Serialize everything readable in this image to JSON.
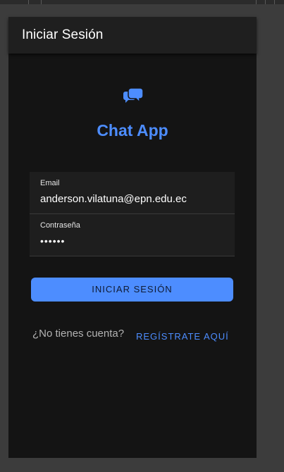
{
  "window": {
    "top_ticks": [
      40,
      58,
      363,
      376,
      389
    ]
  },
  "appbar": {
    "title": "Iniciar Sesión"
  },
  "brand": {
    "icon": "chat-bubbles-icon",
    "name": "Chat App",
    "accent_color": "#4d8dff"
  },
  "form": {
    "email": {
      "label": "Email",
      "value": "anderson.vilatuna@epn.edu.ec"
    },
    "password": {
      "label": "Contraseña",
      "value": "••••••"
    }
  },
  "actions": {
    "login_label": "INICIAR SESIÓN",
    "no_account_text": "¿No tienes cuenta?",
    "register_label": "REGÍSTRATE AQUÍ"
  }
}
